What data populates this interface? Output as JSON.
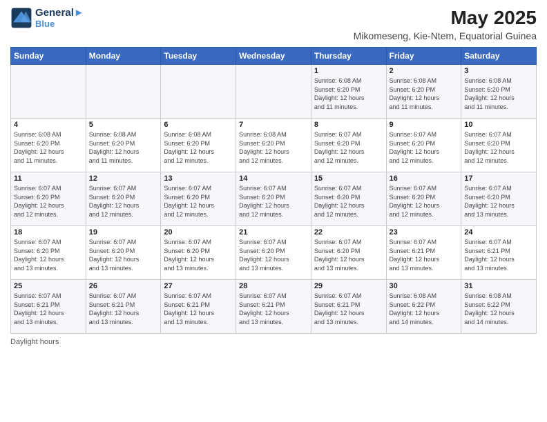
{
  "header": {
    "logo_line1": "General",
    "logo_line2": "Blue",
    "month_year": "May 2025",
    "location": "Mikomeseng, Kie-Ntem, Equatorial Guinea"
  },
  "weekdays": [
    "Sunday",
    "Monday",
    "Tuesday",
    "Wednesday",
    "Thursday",
    "Friday",
    "Saturday"
  ],
  "weeks": [
    [
      {
        "day": "",
        "info": ""
      },
      {
        "day": "",
        "info": ""
      },
      {
        "day": "",
        "info": ""
      },
      {
        "day": "",
        "info": ""
      },
      {
        "day": "1",
        "info": "Sunrise: 6:08 AM\nSunset: 6:20 PM\nDaylight: 12 hours\nand 11 minutes."
      },
      {
        "day": "2",
        "info": "Sunrise: 6:08 AM\nSunset: 6:20 PM\nDaylight: 12 hours\nand 11 minutes."
      },
      {
        "day": "3",
        "info": "Sunrise: 6:08 AM\nSunset: 6:20 PM\nDaylight: 12 hours\nand 11 minutes."
      }
    ],
    [
      {
        "day": "4",
        "info": "Sunrise: 6:08 AM\nSunset: 6:20 PM\nDaylight: 12 hours\nand 11 minutes."
      },
      {
        "day": "5",
        "info": "Sunrise: 6:08 AM\nSunset: 6:20 PM\nDaylight: 12 hours\nand 11 minutes."
      },
      {
        "day": "6",
        "info": "Sunrise: 6:08 AM\nSunset: 6:20 PM\nDaylight: 12 hours\nand 12 minutes."
      },
      {
        "day": "7",
        "info": "Sunrise: 6:08 AM\nSunset: 6:20 PM\nDaylight: 12 hours\nand 12 minutes."
      },
      {
        "day": "8",
        "info": "Sunrise: 6:07 AM\nSunset: 6:20 PM\nDaylight: 12 hours\nand 12 minutes."
      },
      {
        "day": "9",
        "info": "Sunrise: 6:07 AM\nSunset: 6:20 PM\nDaylight: 12 hours\nand 12 minutes."
      },
      {
        "day": "10",
        "info": "Sunrise: 6:07 AM\nSunset: 6:20 PM\nDaylight: 12 hours\nand 12 minutes."
      }
    ],
    [
      {
        "day": "11",
        "info": "Sunrise: 6:07 AM\nSunset: 6:20 PM\nDaylight: 12 hours\nand 12 minutes."
      },
      {
        "day": "12",
        "info": "Sunrise: 6:07 AM\nSunset: 6:20 PM\nDaylight: 12 hours\nand 12 minutes."
      },
      {
        "day": "13",
        "info": "Sunrise: 6:07 AM\nSunset: 6:20 PM\nDaylight: 12 hours\nand 12 minutes."
      },
      {
        "day": "14",
        "info": "Sunrise: 6:07 AM\nSunset: 6:20 PM\nDaylight: 12 hours\nand 12 minutes."
      },
      {
        "day": "15",
        "info": "Sunrise: 6:07 AM\nSunset: 6:20 PM\nDaylight: 12 hours\nand 12 minutes."
      },
      {
        "day": "16",
        "info": "Sunrise: 6:07 AM\nSunset: 6:20 PM\nDaylight: 12 hours\nand 12 minutes."
      },
      {
        "day": "17",
        "info": "Sunrise: 6:07 AM\nSunset: 6:20 PM\nDaylight: 12 hours\nand 13 minutes."
      }
    ],
    [
      {
        "day": "18",
        "info": "Sunrise: 6:07 AM\nSunset: 6:20 PM\nDaylight: 12 hours\nand 13 minutes."
      },
      {
        "day": "19",
        "info": "Sunrise: 6:07 AM\nSunset: 6:20 PM\nDaylight: 12 hours\nand 13 minutes."
      },
      {
        "day": "20",
        "info": "Sunrise: 6:07 AM\nSunset: 6:20 PM\nDaylight: 12 hours\nand 13 minutes."
      },
      {
        "day": "21",
        "info": "Sunrise: 6:07 AM\nSunset: 6:20 PM\nDaylight: 12 hours\nand 13 minutes."
      },
      {
        "day": "22",
        "info": "Sunrise: 6:07 AM\nSunset: 6:20 PM\nDaylight: 12 hours\nand 13 minutes."
      },
      {
        "day": "23",
        "info": "Sunrise: 6:07 AM\nSunset: 6:21 PM\nDaylight: 12 hours\nand 13 minutes."
      },
      {
        "day": "24",
        "info": "Sunrise: 6:07 AM\nSunset: 6:21 PM\nDaylight: 12 hours\nand 13 minutes."
      }
    ],
    [
      {
        "day": "25",
        "info": "Sunrise: 6:07 AM\nSunset: 6:21 PM\nDaylight: 12 hours\nand 13 minutes."
      },
      {
        "day": "26",
        "info": "Sunrise: 6:07 AM\nSunset: 6:21 PM\nDaylight: 12 hours\nand 13 minutes."
      },
      {
        "day": "27",
        "info": "Sunrise: 6:07 AM\nSunset: 6:21 PM\nDaylight: 12 hours\nand 13 minutes."
      },
      {
        "day": "28",
        "info": "Sunrise: 6:07 AM\nSunset: 6:21 PM\nDaylight: 12 hours\nand 13 minutes."
      },
      {
        "day": "29",
        "info": "Sunrise: 6:07 AM\nSunset: 6:21 PM\nDaylight: 12 hours\nand 13 minutes."
      },
      {
        "day": "30",
        "info": "Sunrise: 6:08 AM\nSunset: 6:22 PM\nDaylight: 12 hours\nand 14 minutes."
      },
      {
        "day": "31",
        "info": "Sunrise: 6:08 AM\nSunset: 6:22 PM\nDaylight: 12 hours\nand 14 minutes."
      }
    ]
  ],
  "footer": {
    "daylight_label": "Daylight hours"
  }
}
